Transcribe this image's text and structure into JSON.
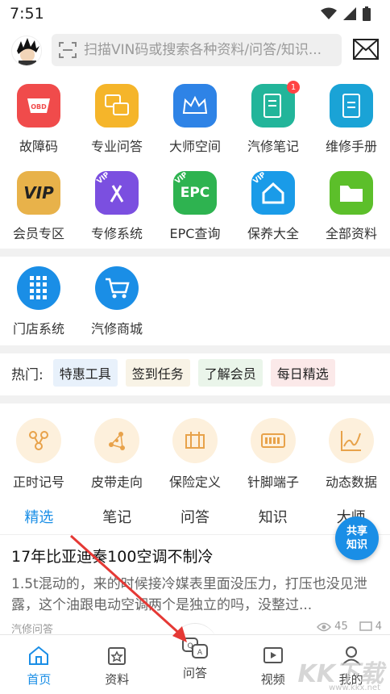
{
  "status": {
    "time": "7:51"
  },
  "search": {
    "placeholder": "扫描VIN码或搜索各种资料/问答/知识..."
  },
  "grid1": [
    {
      "label": "故障码",
      "icon": "obd-icon",
      "color": "#f04b4b"
    },
    {
      "label": "专业问答",
      "icon": "qa-icon",
      "color": "#f5b52a"
    },
    {
      "label": "大师空间",
      "icon": "crown-icon",
      "color": "#2e83e6"
    },
    {
      "label": "汽修笔记",
      "icon": "notebook-icon",
      "color": "#22b59a",
      "badge": "1"
    },
    {
      "label": "维修手册",
      "icon": "manual-icon",
      "color": "#1aa3d6"
    },
    {
      "label": "会员专区",
      "icon": "vip-icon",
      "color": "#e8b24a"
    },
    {
      "label": "专修系统",
      "icon": "tools-icon",
      "color": "#7b4fe0",
      "vip": "VIP"
    },
    {
      "label": "EPC查询",
      "icon": "epc-icon",
      "color": "#2eb350",
      "vip": "VIP"
    },
    {
      "label": "保养大全",
      "icon": "house-icon",
      "color": "#1a9be8",
      "vip": "VIP"
    },
    {
      "label": "全部资料",
      "icon": "folder-icon",
      "color": "#5cbf2a"
    }
  ],
  "badge_vip": "VIP",
  "epc_text": "EPC",
  "vip_big": "VIP",
  "grid2": [
    {
      "label": "门店系统",
      "icon": "store-grid-icon",
      "color": "#1a8ee6"
    },
    {
      "label": "汽修商城",
      "icon": "cart-icon",
      "color": "#1a8ee6"
    }
  ],
  "hot": {
    "label": "热门:",
    "tags": [
      {
        "text": "特惠工具",
        "bg": "#e8f1fb",
        "fg": "#333"
      },
      {
        "text": "签到任务",
        "bg": "#f8f3e6",
        "fg": "#333"
      },
      {
        "text": "了解会员",
        "bg": "#eaf5ea",
        "fg": "#333"
      },
      {
        "text": "每日精选",
        "bg": "#fbe9e9",
        "fg": "#333"
      }
    ]
  },
  "grid3": [
    {
      "label": "正时记号",
      "icon": "timing-icon"
    },
    {
      "label": "皮带走向",
      "icon": "belt-icon"
    },
    {
      "label": "保险定义",
      "icon": "fuse-icon"
    },
    {
      "label": "针脚端子",
      "icon": "pin-icon"
    },
    {
      "label": "动态数据",
      "icon": "graph-icon"
    }
  ],
  "tabs": [
    "精选",
    "笔记",
    "问答",
    "知识",
    "大师"
  ],
  "share": {
    "line1": "共享",
    "line2": "知识"
  },
  "article": {
    "title": "17年比亚迪秦100空调不制冷",
    "body": "1.5t混动的，来的时候接冷媒表里面没压力，打压也没见泄露，这个油跟电动空调两个是独立的吗，没整过...",
    "source": "汽修问答",
    "views": "45",
    "comments": "4"
  },
  "nav": [
    {
      "label": "首页",
      "icon": "home-icon"
    },
    {
      "label": "资料",
      "icon": "docs-icon"
    },
    {
      "label": "问答",
      "icon": "qa-bubble-icon"
    },
    {
      "label": "视频",
      "icon": "video-icon"
    },
    {
      "label": "我的",
      "icon": "profile-icon"
    }
  ],
  "watermark": {
    "big": "KK下载",
    "small": "www.kkx.net"
  },
  "colors": {
    "accent": "#1a8ee6",
    "badge": "#ff4444"
  }
}
